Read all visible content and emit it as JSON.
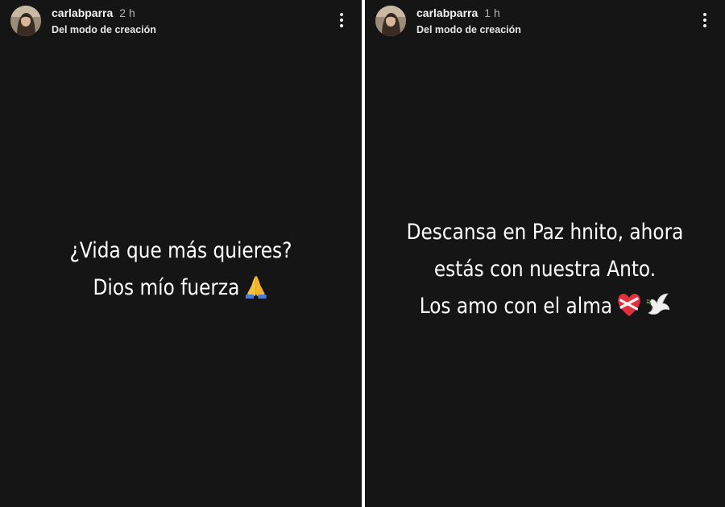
{
  "stories": [
    {
      "username": "carlabparra",
      "time": "2 h",
      "subtitle": "Del modo de creación",
      "lines": [
        "¿Vida que más quieres?",
        "Dios mío fuerza"
      ],
      "emojis": [
        "praying-hands"
      ]
    },
    {
      "username": "carlabparra",
      "time": "1 h",
      "subtitle": "Del modo de creación",
      "lines": [
        "Descansa en Paz hnito, ahora",
        "estás con nuestra Anto.",
        "Los amo con el alma"
      ],
      "emojis": [
        "mending-heart",
        "dove"
      ]
    }
  ],
  "colors": {
    "story_background": "#151515",
    "separator": "#ffffff",
    "text": "#ffffff"
  }
}
